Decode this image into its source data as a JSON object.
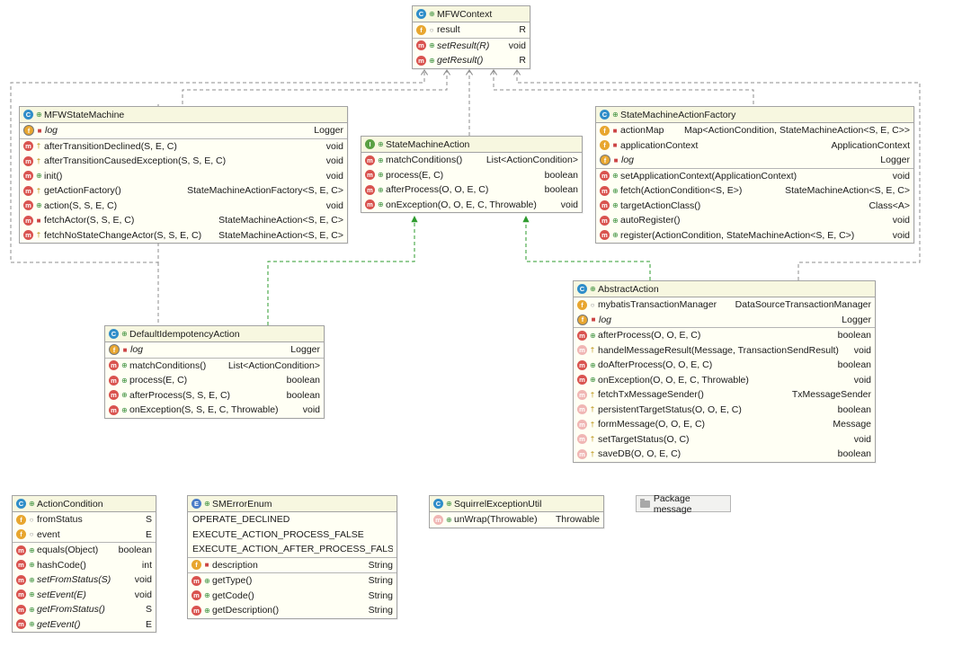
{
  "classes": {
    "mfw_context": {
      "name": "MFWContext",
      "fields": [
        {
          "name": "result",
          "type": "R"
        }
      ],
      "methods": [
        {
          "name": "setResult(R)",
          "type": "void"
        },
        {
          "name": "getResult()",
          "type": "R"
        }
      ]
    },
    "mfw_state_machine": {
      "name": "MFWStateMachine",
      "fields": [
        {
          "name": "log",
          "type": "Logger"
        }
      ],
      "methods": [
        {
          "name": "afterTransitionDeclined(S, E, C)",
          "type": "void"
        },
        {
          "name": "afterTransitionCausedException(S, S, E, C)",
          "type": "void"
        },
        {
          "name": "init()",
          "type": "void"
        },
        {
          "name": "getActionFactory()",
          "type": "StateMachineActionFactory<S, E, C>"
        },
        {
          "name": "action(S, S, E, C)",
          "type": "void"
        },
        {
          "name": "fetchActor(S, S, E, C)",
          "type": "StateMachineAction<S, E, C>"
        },
        {
          "name": "fetchNoStateChangeActor(S, S, E, C)",
          "type": "StateMachineAction<S, E, C>"
        }
      ]
    },
    "state_machine_action": {
      "name": "StateMachineAction",
      "methods": [
        {
          "name": "matchConditions()",
          "type": "List<ActionCondition>"
        },
        {
          "name": "process(E, C)",
          "type": "boolean"
        },
        {
          "name": "afterProcess(O, O, E, C)",
          "type": "boolean"
        },
        {
          "name": "onException(O, O, E, C, Throwable)",
          "type": "void"
        }
      ]
    },
    "state_machine_action_factory": {
      "name": "StateMachineActionFactory",
      "fields": [
        {
          "name": "actionMap",
          "type": "Map<ActionCondition, StateMachineAction<S, E, C>>"
        },
        {
          "name": "applicationContext",
          "type": "ApplicationContext"
        },
        {
          "name": "log",
          "type": "Logger"
        }
      ],
      "methods": [
        {
          "name": "setApplicationContext(ApplicationContext)",
          "type": "void"
        },
        {
          "name": "fetch(ActionCondition<S, E>)",
          "type": "StateMachineAction<S, E, C>"
        },
        {
          "name": "targetActionClass()",
          "type": "Class<A>"
        },
        {
          "name": "autoRegister()",
          "type": "void"
        },
        {
          "name": "register(ActionCondition, StateMachineAction<S, E, C>)",
          "type": "void"
        }
      ]
    },
    "default_idempotency_action": {
      "name": "DefaultIdempotencyAction",
      "fields": [
        {
          "name": "log",
          "type": "Logger"
        }
      ],
      "methods": [
        {
          "name": "matchConditions()",
          "type": "List<ActionCondition>"
        },
        {
          "name": "process(E, C)",
          "type": "boolean"
        },
        {
          "name": "afterProcess(S, S, E, C)",
          "type": "boolean"
        },
        {
          "name": "onException(S, S, E, C, Throwable)",
          "type": "void"
        }
      ]
    },
    "abstract_action": {
      "name": "AbstractAction",
      "fields": [
        {
          "name": "mybatisTransactionManager",
          "type": "DataSourceTransactionManager"
        },
        {
          "name": "log",
          "type": "Logger"
        }
      ],
      "methods": [
        {
          "name": "afterProcess(O, O, E, C)",
          "type": "boolean"
        },
        {
          "name": "handelMessageResult(Message, TransactionSendResult)",
          "type": "void"
        },
        {
          "name": "doAfterProcess(O, O, E, C)",
          "type": "boolean"
        },
        {
          "name": "onException(O, O, E, C, Throwable)",
          "type": "void"
        },
        {
          "name": "fetchTxMessageSender()",
          "type": "TxMessageSender"
        },
        {
          "name": "persistentTargetStatus(O, O, E, C)",
          "type": "boolean"
        },
        {
          "name": "formMessage(O, O, E, C)",
          "type": "Message"
        },
        {
          "name": "setTargetStatus(O, C)",
          "type": "void"
        },
        {
          "name": "saveDB(O, O, E, C)",
          "type": "boolean"
        }
      ]
    },
    "action_condition": {
      "name": "ActionCondition",
      "fields": [
        {
          "name": "fromStatus",
          "type": "S"
        },
        {
          "name": "event",
          "type": "E"
        }
      ],
      "methods": [
        {
          "name": "equals(Object)",
          "type": "boolean"
        },
        {
          "name": "hashCode()",
          "type": "int"
        },
        {
          "name": "setFromStatus(S)",
          "type": "void"
        },
        {
          "name": "setEvent(E)",
          "type": "void"
        },
        {
          "name": "getFromStatus()",
          "type": "S"
        },
        {
          "name": "getEvent()",
          "type": "E"
        }
      ]
    },
    "sm_error_enum": {
      "name": "SMErrorEnum",
      "constants": [
        "OPERATE_DECLINED",
        "EXECUTE_ACTION_PROCESS_FALSE",
        "EXECUTE_ACTION_AFTER_PROCESS_FALSE"
      ],
      "fields": [
        {
          "name": "description",
          "type": "String"
        }
      ],
      "methods": [
        {
          "name": "getType()",
          "type": "String"
        },
        {
          "name": "getCode()",
          "type": "String"
        },
        {
          "name": "getDescription()",
          "type": "String"
        }
      ]
    },
    "squirrel_exception_util": {
      "name": "SquirrelExceptionUtil",
      "methods": [
        {
          "name": "unWrap(Throwable)",
          "type": "Throwable"
        }
      ]
    }
  },
  "package": {
    "label": "Package message"
  },
  "colors": {
    "dashed_line": "#8c8c8c",
    "realization_line": "#2e9b2e",
    "header_bg": "#f7f7e0",
    "body_bg": "#fffff4"
  }
}
